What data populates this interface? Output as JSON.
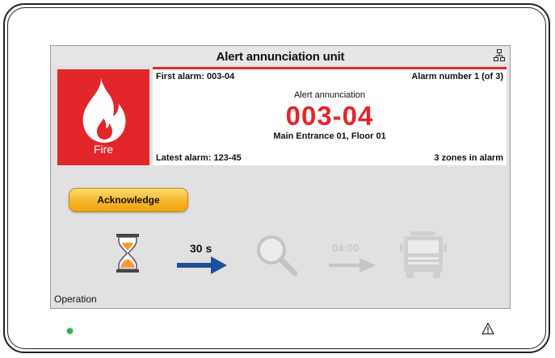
{
  "header": {
    "title": "Alert annunciation unit",
    "network_icon": "network-icon"
  },
  "fire_tile": {
    "label": "Fire",
    "icon": "flame-icon",
    "color": "#e3262a"
  },
  "alarm": {
    "first_alarm": "First alarm: 003-04",
    "alarm_number": "Alarm number 1 (of 3)",
    "title": "Alert annunciation",
    "zone": "003-04",
    "location": "Main Entrance 01, Floor 01",
    "latest_alarm": "Latest alarm: 123-45",
    "zones_in_alarm": "3 zones in alarm",
    "accent": "#e3262a"
  },
  "actions": {
    "acknowledge_label": "Acknowledge"
  },
  "timeline": {
    "acknowledge_timer": "30 s",
    "investigation_timer": "04:00",
    "icons": [
      "hourglass-icon",
      "arrow-icon",
      "magnifier-icon",
      "arrow-icon",
      "fire-truck-icon"
    ]
  },
  "status": {
    "mode": "Operation",
    "led_color": "#2fb44a",
    "warning_icon": "warning-icon"
  }
}
